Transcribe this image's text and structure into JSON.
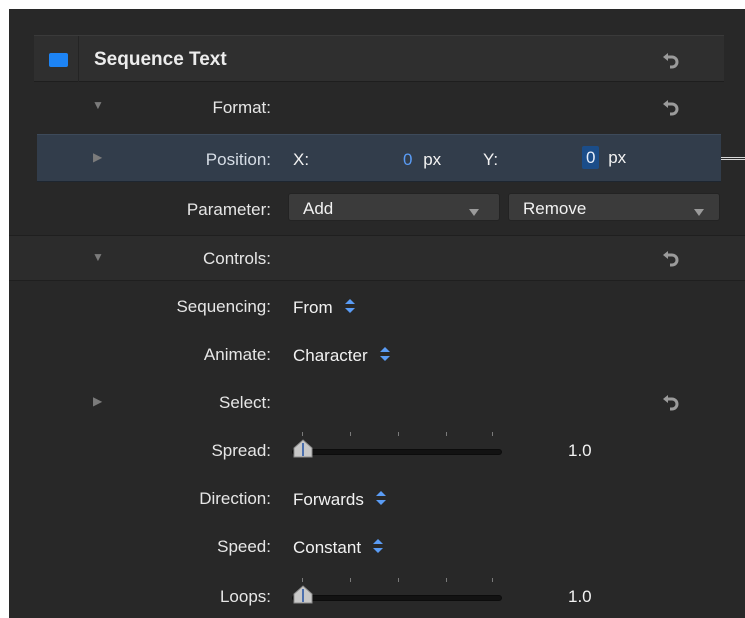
{
  "panel": {
    "title": "Sequence Text",
    "accent_color": "#1d84f5",
    "enable_checked": true
  },
  "rows": {
    "format": {
      "label": "Format:",
      "expanded": true
    },
    "position": {
      "label": "Position:",
      "expanded": false,
      "x_label": "X:",
      "x_value": "0",
      "x_unit": "px",
      "y_label": "Y:",
      "y_value": "0",
      "y_unit": "px"
    },
    "parameter": {
      "label": "Parameter:",
      "add_label": "Add",
      "remove_label": "Remove"
    },
    "controls": {
      "label": "Controls:",
      "expanded": true
    },
    "sequencing": {
      "label": "Sequencing:",
      "value": "From"
    },
    "animate": {
      "label": "Animate:",
      "value": "Character"
    },
    "select": {
      "label": "Select:",
      "expanded": false
    },
    "spread": {
      "label": "Spread:",
      "value": "1.0"
    },
    "direction": {
      "label": "Direction:",
      "value": "Forwards"
    },
    "speed": {
      "label": "Speed:",
      "value": "Constant"
    },
    "loops": {
      "label": "Loops:",
      "value": "1.0"
    }
  },
  "icons": {
    "enable": "checkbox-icon",
    "revert": "revert-arrow-icon",
    "disclosure": "disclosure-triangle-icon",
    "stepper": "up-down-stepper-icon",
    "popup": "dropdown-arrow-icon",
    "slider_knob": "slider-knob-icon"
  },
  "colors": {
    "background": "#282828",
    "header": "#2f2f2f",
    "selected_row": "#323d4b",
    "accent_blue": "#5a9cf5",
    "value_highlight": "#1b4d89"
  }
}
